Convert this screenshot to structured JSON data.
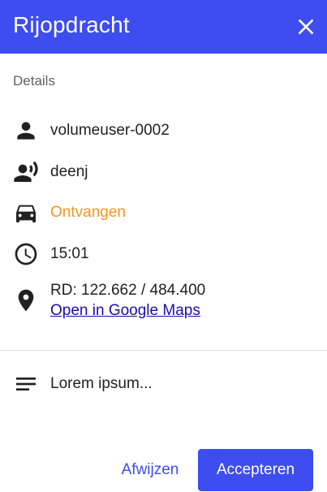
{
  "header": {
    "title": "Rijopdracht",
    "close_icon": "close-icon",
    "background_color": "#3d4df0"
  },
  "details": {
    "section_label": "Details",
    "user": {
      "icon": "person-icon",
      "value": "volumeuser-0002"
    },
    "voice": {
      "icon": "record-voice-icon",
      "value": "deenj"
    },
    "status": {
      "icon": "car-icon",
      "value": "Ontvangen",
      "color": "#f7941d"
    },
    "time": {
      "icon": "clock-icon",
      "value": "15:01"
    },
    "location": {
      "icon": "location-pin-icon",
      "coordinates": "RD: 122.662 / 484.400",
      "maps_link": "Open in Google Maps"
    }
  },
  "note": {
    "icon": "notes-icon",
    "text": "Lorem ipsum..."
  },
  "actions": {
    "reject_label": "Afwijzen",
    "accept_label": "Accepteren",
    "accent_color": "#3d4df0"
  }
}
